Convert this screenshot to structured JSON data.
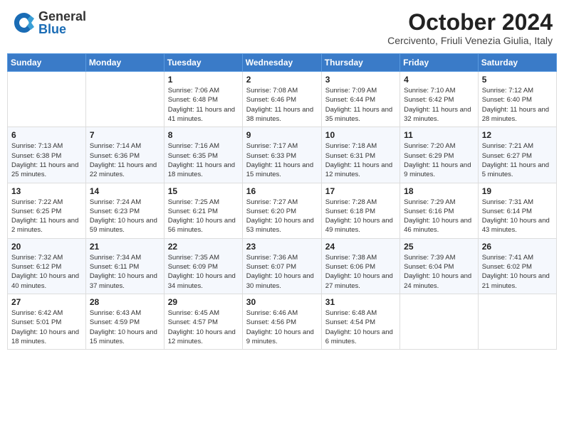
{
  "header": {
    "logo_general": "General",
    "logo_blue": "Blue",
    "month_title": "October 2024",
    "location": "Cercivento, Friuli Venezia Giulia, Italy"
  },
  "weekdays": [
    "Sunday",
    "Monday",
    "Tuesday",
    "Wednesday",
    "Thursday",
    "Friday",
    "Saturday"
  ],
  "weeks": [
    [
      {
        "day": "",
        "info": ""
      },
      {
        "day": "",
        "info": ""
      },
      {
        "day": "1",
        "info": "Sunrise: 7:06 AM\nSunset: 6:48 PM\nDaylight: 11 hours and 41 minutes."
      },
      {
        "day": "2",
        "info": "Sunrise: 7:08 AM\nSunset: 6:46 PM\nDaylight: 11 hours and 38 minutes."
      },
      {
        "day": "3",
        "info": "Sunrise: 7:09 AM\nSunset: 6:44 PM\nDaylight: 11 hours and 35 minutes."
      },
      {
        "day": "4",
        "info": "Sunrise: 7:10 AM\nSunset: 6:42 PM\nDaylight: 11 hours and 32 minutes."
      },
      {
        "day": "5",
        "info": "Sunrise: 7:12 AM\nSunset: 6:40 PM\nDaylight: 11 hours and 28 minutes."
      }
    ],
    [
      {
        "day": "6",
        "info": "Sunrise: 7:13 AM\nSunset: 6:38 PM\nDaylight: 11 hours and 25 minutes."
      },
      {
        "day": "7",
        "info": "Sunrise: 7:14 AM\nSunset: 6:36 PM\nDaylight: 11 hours and 22 minutes."
      },
      {
        "day": "8",
        "info": "Sunrise: 7:16 AM\nSunset: 6:35 PM\nDaylight: 11 hours and 18 minutes."
      },
      {
        "day": "9",
        "info": "Sunrise: 7:17 AM\nSunset: 6:33 PM\nDaylight: 11 hours and 15 minutes."
      },
      {
        "day": "10",
        "info": "Sunrise: 7:18 AM\nSunset: 6:31 PM\nDaylight: 11 hours and 12 minutes."
      },
      {
        "day": "11",
        "info": "Sunrise: 7:20 AM\nSunset: 6:29 PM\nDaylight: 11 hours and 9 minutes."
      },
      {
        "day": "12",
        "info": "Sunrise: 7:21 AM\nSunset: 6:27 PM\nDaylight: 11 hours and 5 minutes."
      }
    ],
    [
      {
        "day": "13",
        "info": "Sunrise: 7:22 AM\nSunset: 6:25 PM\nDaylight: 11 hours and 2 minutes."
      },
      {
        "day": "14",
        "info": "Sunrise: 7:24 AM\nSunset: 6:23 PM\nDaylight: 10 hours and 59 minutes."
      },
      {
        "day": "15",
        "info": "Sunrise: 7:25 AM\nSunset: 6:21 PM\nDaylight: 10 hours and 56 minutes."
      },
      {
        "day": "16",
        "info": "Sunrise: 7:27 AM\nSunset: 6:20 PM\nDaylight: 10 hours and 53 minutes."
      },
      {
        "day": "17",
        "info": "Sunrise: 7:28 AM\nSunset: 6:18 PM\nDaylight: 10 hours and 49 minutes."
      },
      {
        "day": "18",
        "info": "Sunrise: 7:29 AM\nSunset: 6:16 PM\nDaylight: 10 hours and 46 minutes."
      },
      {
        "day": "19",
        "info": "Sunrise: 7:31 AM\nSunset: 6:14 PM\nDaylight: 10 hours and 43 minutes."
      }
    ],
    [
      {
        "day": "20",
        "info": "Sunrise: 7:32 AM\nSunset: 6:12 PM\nDaylight: 10 hours and 40 minutes."
      },
      {
        "day": "21",
        "info": "Sunrise: 7:34 AM\nSunset: 6:11 PM\nDaylight: 10 hours and 37 minutes."
      },
      {
        "day": "22",
        "info": "Sunrise: 7:35 AM\nSunset: 6:09 PM\nDaylight: 10 hours and 34 minutes."
      },
      {
        "day": "23",
        "info": "Sunrise: 7:36 AM\nSunset: 6:07 PM\nDaylight: 10 hours and 30 minutes."
      },
      {
        "day": "24",
        "info": "Sunrise: 7:38 AM\nSunset: 6:06 PM\nDaylight: 10 hours and 27 minutes."
      },
      {
        "day": "25",
        "info": "Sunrise: 7:39 AM\nSunset: 6:04 PM\nDaylight: 10 hours and 24 minutes."
      },
      {
        "day": "26",
        "info": "Sunrise: 7:41 AM\nSunset: 6:02 PM\nDaylight: 10 hours and 21 minutes."
      }
    ],
    [
      {
        "day": "27",
        "info": "Sunrise: 6:42 AM\nSunset: 5:01 PM\nDaylight: 10 hours and 18 minutes."
      },
      {
        "day": "28",
        "info": "Sunrise: 6:43 AM\nSunset: 4:59 PM\nDaylight: 10 hours and 15 minutes."
      },
      {
        "day": "29",
        "info": "Sunrise: 6:45 AM\nSunset: 4:57 PM\nDaylight: 10 hours and 12 minutes."
      },
      {
        "day": "30",
        "info": "Sunrise: 6:46 AM\nSunset: 4:56 PM\nDaylight: 10 hours and 9 minutes."
      },
      {
        "day": "31",
        "info": "Sunrise: 6:48 AM\nSunset: 4:54 PM\nDaylight: 10 hours and 6 minutes."
      },
      {
        "day": "",
        "info": ""
      },
      {
        "day": "",
        "info": ""
      }
    ]
  ]
}
